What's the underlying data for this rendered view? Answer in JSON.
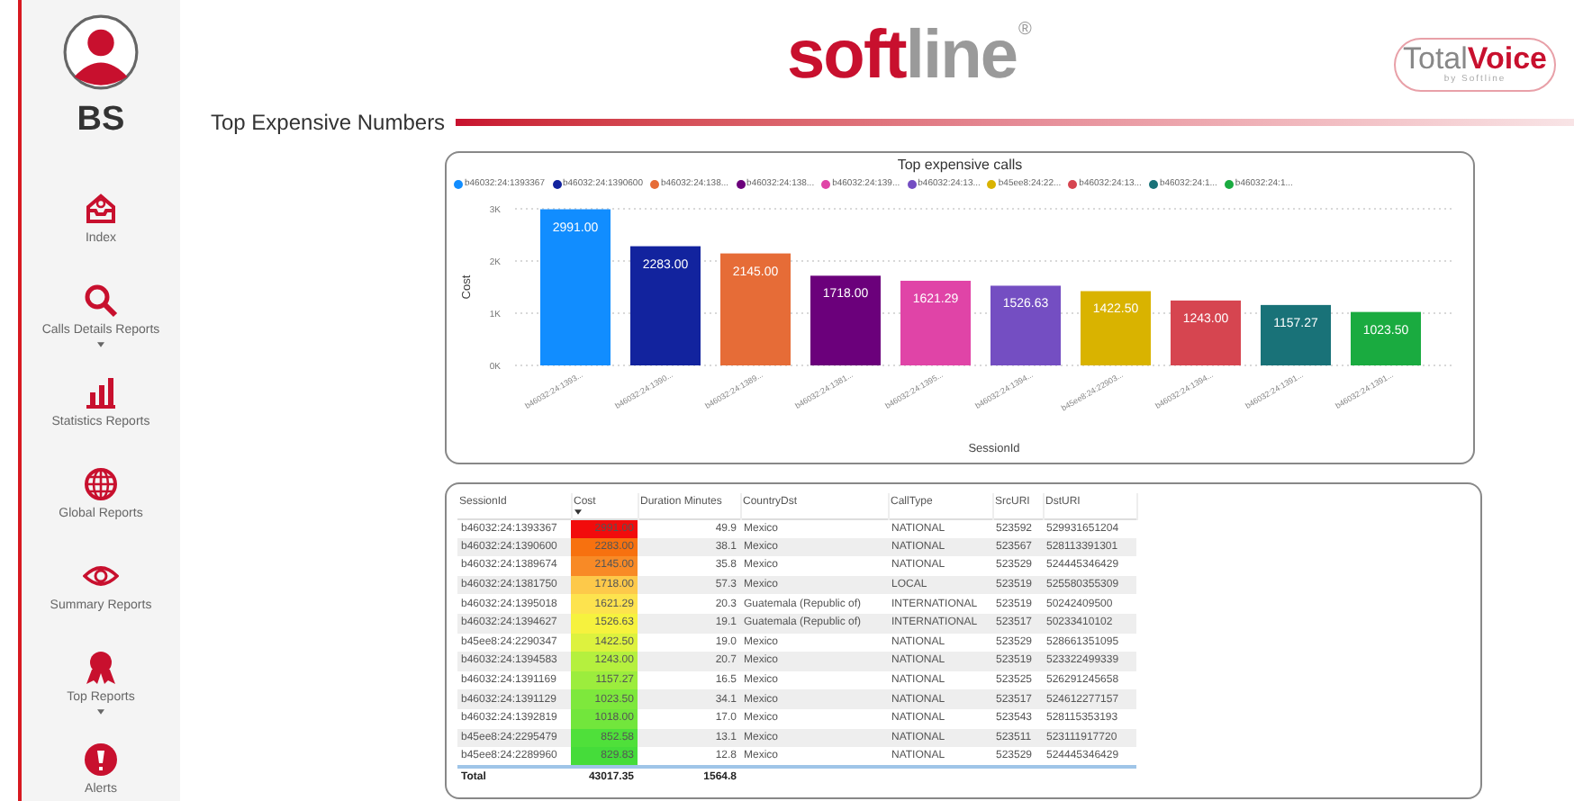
{
  "sidebar": {
    "initials": "BS",
    "items": [
      {
        "label": "Index",
        "caret": false
      },
      {
        "label": "Calls Details Reports",
        "caret": true
      },
      {
        "label": "Statistics Reports",
        "caret": false
      },
      {
        "label": "Global Reports",
        "caret": false
      },
      {
        "label": "Summary Reports",
        "caret": false
      },
      {
        "label": "Top Reports",
        "caret": true
      },
      {
        "label": "Alerts",
        "caret": false
      }
    ]
  },
  "header": {
    "logo": {
      "first": "soft",
      "second": "line",
      "mark": "®"
    },
    "product": {
      "first": "Total",
      "second": "Voice",
      "tagline": "by Softline"
    }
  },
  "page_title": "Top Expensive Numbers",
  "chart": {
    "legend": [
      {
        "label": "b46032:24:1393367",
        "color": "#118dff"
      },
      {
        "label": "b46032:24:1390600",
        "color": "#12239e"
      },
      {
        "label": "b46032:24:138...",
        "color": "#e66c37"
      },
      {
        "label": "b46032:24:138...",
        "color": "#6b007b"
      },
      {
        "label": "b46032:24:139...",
        "color": "#e044a7"
      },
      {
        "label": "b46032:24:13...",
        "color": "#744ec2"
      },
      {
        "label": "b45ee8:24:22...",
        "color": "#d9b300"
      },
      {
        "label": "b46032:24:13...",
        "color": "#d64550"
      },
      {
        "label": "b46032:24:1...",
        "color": "#197278"
      },
      {
        "label": "b46032:24:1...",
        "color": "#1aab40"
      }
    ],
    "chart_data": {
      "type": "bar",
      "title": "Top expensive calls",
      "xlabel": "SessionId",
      "ylabel": "Cost",
      "categories": [
        "b46032:24:1393...",
        "b46032:24:1390...",
        "b46032:24:1389...",
        "b46032:24:1381...",
        "b46032:24:1395...",
        "b46032:24:1394...",
        "b45ee8:24:22903...",
        "b46032:24:1394...",
        "b46032:24:1391...",
        "b46032:24:1391..."
      ],
      "values": [
        2991,
        2283,
        2145,
        1718,
        1621.29,
        1526.63,
        1422.5,
        1243,
        1157.27,
        1023.5
      ],
      "value_labels": [
        "2991.00",
        "2283.00",
        "2145.00",
        "1718.00",
        "1621.29",
        "1526.63",
        "1422.50",
        "1243.00",
        "1157.27",
        "1023.50"
      ],
      "ylim": [
        0,
        3000
      ],
      "yticks": [
        {
          "value": 0,
          "label": "0K"
        },
        {
          "value": 1000,
          "label": "1K"
        },
        {
          "value": 2000,
          "label": "2K"
        },
        {
          "value": 3000,
          "label": "3K"
        }
      ]
    }
  },
  "table": {
    "columns": [
      {
        "label": "SessionId",
        "sorted": false
      },
      {
        "label": "Cost",
        "sorted": true
      },
      {
        "label": "Duration Minutes",
        "sorted": false
      },
      {
        "label": "CountryDst",
        "sorted": false
      },
      {
        "label": "CallType",
        "sorted": false
      },
      {
        "label": "SrcURI",
        "sorted": false
      },
      {
        "label": "DstURI",
        "sorted": false
      }
    ],
    "rows": [
      {
        "cells": [
          "b46032:24:1393367",
          "2991.00",
          "49.9",
          "Mexico",
          "NATIONAL",
          "523592",
          "529931651204"
        ],
        "color": "#f20c0c"
      },
      {
        "cells": [
          "b46032:24:1390600",
          "2283.00",
          "38.1",
          "Mexico",
          "NATIONAL",
          "523567",
          "528113391301"
        ],
        "color": "#f7710f"
      },
      {
        "cells": [
          "b46032:24:1389674",
          "2145.00",
          "35.8",
          "Mexico",
          "NATIONAL",
          "523529",
          "524445346429"
        ],
        "color": "#f88a26"
      },
      {
        "cells": [
          "b46032:24:1381750",
          "1718.00",
          "57.3",
          "Mexico",
          "LOCAL",
          "523519",
          "525580355309"
        ],
        "color": "#fdc94a"
      },
      {
        "cells": [
          "b46032:24:1395018",
          "1621.29",
          "20.3",
          "Guatemala (Republic of)",
          "INTERNATIONAL",
          "523519",
          "50242409500"
        ],
        "color": "#fde34e"
      },
      {
        "cells": [
          "b46032:24:1394627",
          "1526.63",
          "19.1",
          "Guatemala (Republic of)",
          "INTERNATIONAL",
          "523517",
          "50233410102"
        ],
        "color": "#f6f23e"
      },
      {
        "cells": [
          "b45ee8:24:2290347",
          "1422.50",
          "19.0",
          "Mexico",
          "NATIONAL",
          "523529",
          "528661351095"
        ],
        "color": "#ddf23e"
      },
      {
        "cells": [
          "b46032:24:1394583",
          "1243.00",
          "20.7",
          "Mexico",
          "NATIONAL",
          "523519",
          "523322499339"
        ],
        "color": "#b5f03e"
      },
      {
        "cells": [
          "b46032:24:1391169",
          "1157.27",
          "16.5",
          "Mexico",
          "NATIONAL",
          "523525",
          "526291245658"
        ],
        "color": "#9ced3d"
      },
      {
        "cells": [
          "b46032:24:1391129",
          "1023.50",
          "34.1",
          "Mexico",
          "NATIONAL",
          "523517",
          "524612277157"
        ],
        "color": "#7ee83c"
      },
      {
        "cells": [
          "b46032:24:1392819",
          "1018.00",
          "17.0",
          "Mexico",
          "NATIONAL",
          "523543",
          "528115353193"
        ],
        "color": "#72e63c"
      },
      {
        "cells": [
          "b45ee8:24:2295479",
          "852.58",
          "13.1",
          "Mexico",
          "NATIONAL",
          "523511",
          "523111917720"
        ],
        "color": "#4fe03a"
      },
      {
        "cells": [
          "b45ee8:24:2289960",
          "829.83",
          "12.8",
          "Mexico",
          "NATIONAL",
          "523529",
          "524445346429"
        ],
        "color": "#45dc3a"
      }
    ],
    "total": {
      "label": "Total",
      "cost": "43017.35",
      "duration": "1564.8"
    }
  }
}
